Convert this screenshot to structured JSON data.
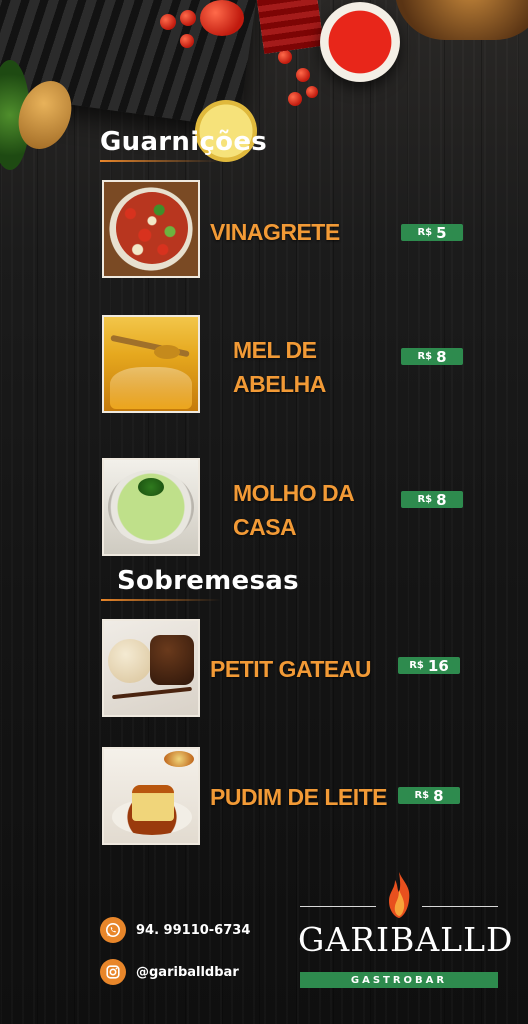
{
  "sections": [
    {
      "title": "Guarnições",
      "items": [
        {
          "name_lines": [
            "VINAGRETE"
          ],
          "currency": "R$",
          "price": "5",
          "image": "vinaigrette-bowl"
        },
        {
          "name_lines": [
            "MEL DE",
            "ABELHA"
          ],
          "currency": "R$",
          "price": "8",
          "image": "honey-jar"
        },
        {
          "name_lines": [
            "MOLHO DA",
            "CASA"
          ],
          "currency": "R$",
          "price": "8",
          "image": "green-sauce-bowl"
        }
      ]
    },
    {
      "title": "Sobremesas",
      "items": [
        {
          "name_lines": [
            "PETIT GATEAU"
          ],
          "currency": "R$",
          "price": "16",
          "image": "petit-gateau-plate"
        },
        {
          "name_lines": [
            "PUDIM DE LEITE"
          ],
          "currency": "R$",
          "price": "8",
          "image": "flan-plate"
        }
      ]
    }
  ],
  "footer": {
    "phone": "94. 99110-6734",
    "instagram": "@gariballdbar",
    "phone_icon": "whatsapp-icon",
    "instagram_icon": "instagram-icon"
  },
  "brand": {
    "name": "GARIBALLD",
    "tagline": "GASTROBAR",
    "flame_icon": "flame-icon"
  },
  "colors": {
    "item_name": "#f29a36",
    "price_badge": "#2e8b4e",
    "accent": "#e8862a",
    "background": "#141414"
  }
}
